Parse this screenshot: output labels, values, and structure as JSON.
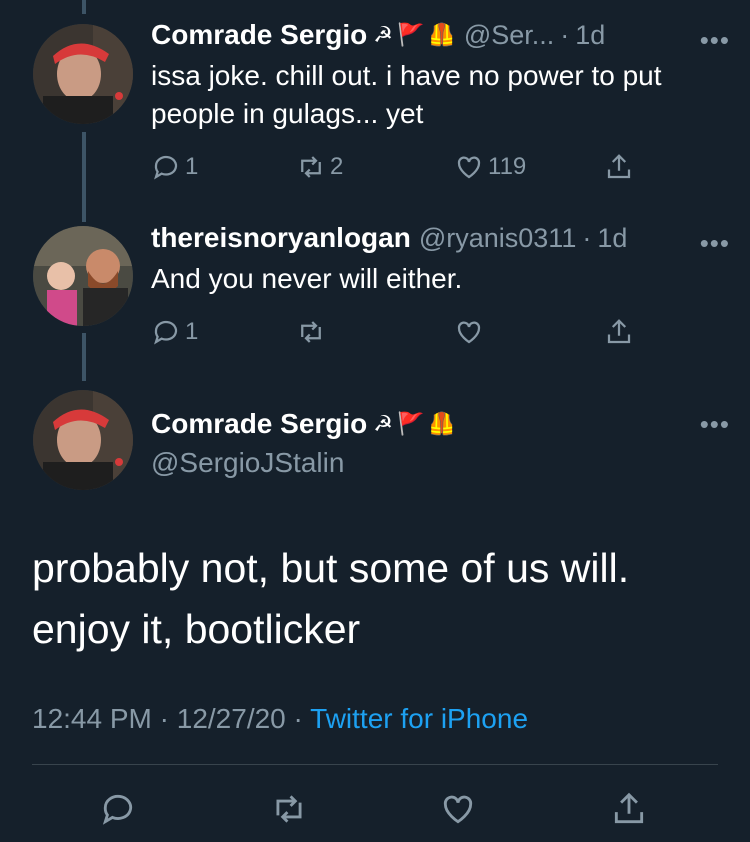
{
  "tweets": [
    {
      "name": "Comrade Sergio",
      "badges": [
        "☭",
        "🚩",
        "🦺"
      ],
      "handle": "@Ser...",
      "time_sep": "·",
      "time": "1d",
      "more": "•••",
      "text": "issa joke. chill out. i have no power to put people in gulags... yet",
      "replies": "1",
      "retweets": "2",
      "likes": "119"
    },
    {
      "name": "thereisnoryanlogan",
      "handle": "@ryanis0311",
      "time_sep": "·",
      "time": "1d",
      "more": "•••",
      "text": "And you never will either.",
      "replies": "1",
      "retweets": "",
      "likes": ""
    }
  ],
  "main_tweet": {
    "name": "Comrade Sergio",
    "badges": [
      "☭",
      "🚩",
      "🦺"
    ],
    "handle": "@SergioJStalin",
    "more": "•••",
    "text_line1": "probably not, but some of us will.",
    "text_line2": "enjoy it, bootlicker",
    "time": "12:44 PM",
    "sep1": "·",
    "date": "12/27/20",
    "sep2": "·",
    "source": "Twitter for iPhone"
  },
  "colors": {
    "background": "#15202b",
    "secondary_text": "#8899a6",
    "link": "#1da1f2"
  },
  "icons": [
    "reply-icon",
    "retweet-icon",
    "like-icon",
    "share-icon"
  ]
}
